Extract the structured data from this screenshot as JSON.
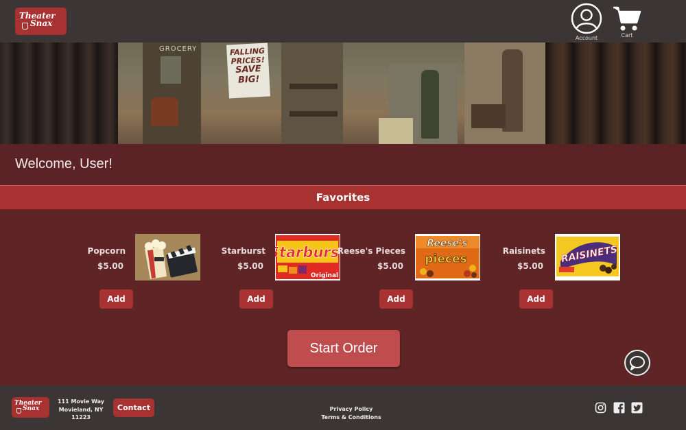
{
  "brand": {
    "line1": "Theater",
    "line2": "Snax"
  },
  "header": {
    "account_label": "Account",
    "cart_label": "Cart"
  },
  "banner": {
    "sign_line1": "FALLING",
    "sign_line2": "PRICES!",
    "sign_line3": "SAVE",
    "sign_line4": "BIG!",
    "store_sign": "GROCERY"
  },
  "welcome": "Welcome, User!",
  "favorites_title": "Favorites",
  "items": [
    {
      "name": "Popcorn",
      "price": "$5.00",
      "add": "Add"
    },
    {
      "name": "Starburst",
      "price": "$5.00",
      "add": "Add"
    },
    {
      "name": "Reese's Pieces",
      "price": "$5.00",
      "add": "Add"
    },
    {
      "name": "Raisinets",
      "price": "$5.00",
      "add": "Add"
    }
  ],
  "start_order": "Start Order",
  "footer": {
    "address_line1": "111 Movie Way",
    "address_line2": "Movieland, NY 11223",
    "contact": "Contact",
    "privacy": "Privacy Policy",
    "terms": "Terms & Conditions"
  },
  "colors": {
    "header_bg": "#3b3535",
    "accent": "#a83232",
    "page_bg": "#5e2426",
    "start_button": "#bf4d4d"
  },
  "icons": [
    "account-icon",
    "cart-icon",
    "chat-icon",
    "instagram-icon",
    "facebook-icon",
    "twitter-icon"
  ]
}
